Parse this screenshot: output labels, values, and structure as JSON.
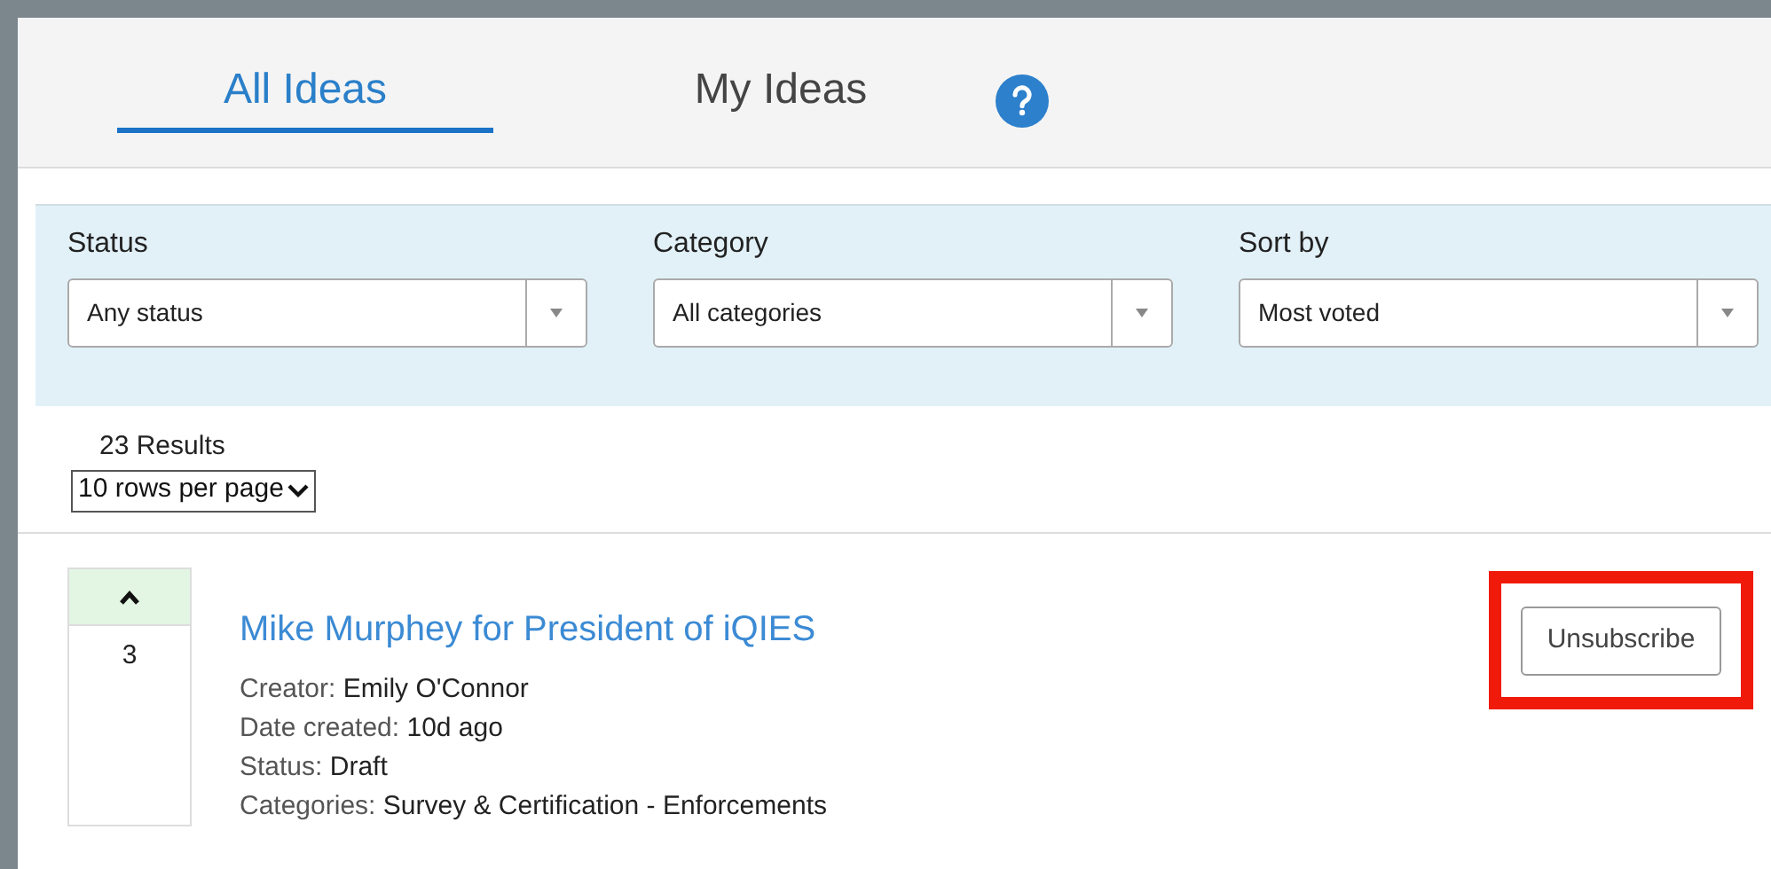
{
  "tabs": [
    {
      "label": "All Ideas",
      "selected": true
    },
    {
      "label": "My Ideas",
      "selected": false
    }
  ],
  "filters": [
    {
      "label": "Status",
      "value": "Any status"
    },
    {
      "label": "Category",
      "value": "All categories"
    },
    {
      "label": "Sort by",
      "value": "Most voted"
    }
  ],
  "results": {
    "count": "23 Results",
    "page_size": "10 rows per page"
  },
  "ideas": [
    {
      "votes": "3",
      "voted": true,
      "title": "Mike Murphey for President of iQIES",
      "meta": [
        {
          "label": "Creator:",
          "value": "Emily O'Connor"
        },
        {
          "label": "Date created:",
          "value": "10d ago"
        },
        {
          "label": "Status:",
          "value": "Draft"
        },
        {
          "label": "Categories:",
          "value": "Survey & Certification - Enforcements"
        }
      ],
      "button": "Unsubscribe",
      "highlighted": true
    }
  ]
}
